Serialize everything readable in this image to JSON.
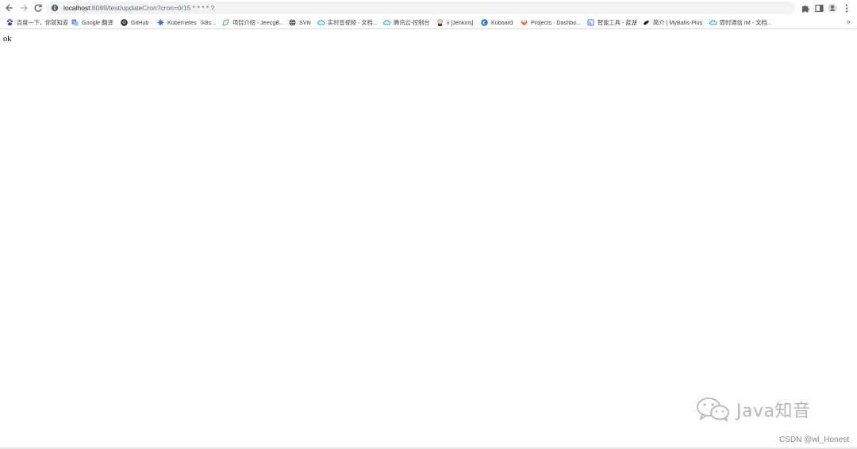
{
  "address_bar": {
    "host": "localhost",
    "rest": ":8089/test/updateCron?cron=0/15 * * * * ?"
  },
  "bookmarks": [
    {
      "label": "百度一下，你就知道",
      "icon": "paw-icon",
      "color": "#2932e1"
    },
    {
      "label": "Google 翻译",
      "icon": "translate-icon",
      "color": "#4285f4"
    },
    {
      "label": "GitHub",
      "icon": "github-icon",
      "color": "#24292e"
    },
    {
      "label": "Kubernetes（k8s...",
      "icon": "helm-icon",
      "color": "#326ce5"
    },
    {
      "label": "项目介绍 - JeecgB...",
      "icon": "leaf-icon",
      "color": "#3fb950"
    },
    {
      "label": "SVN",
      "icon": "globe-icon",
      "color": "#444444"
    },
    {
      "label": "实时音视频 - 文档...",
      "icon": "cloud-icon",
      "color": "#00a4ff"
    },
    {
      "label": "腾讯云-控制台",
      "icon": "cloud-icon",
      "color": "#00a4ff"
    },
    {
      "label": "ii [Jenkins]",
      "icon": "jenkins-icon",
      "color": "#d24939"
    },
    {
      "label": "Kuboard",
      "icon": "kuboard-icon",
      "color": "#1a73e8"
    },
    {
      "label": "Projects · Dashbo...",
      "icon": "gitlab-icon",
      "color": "#fc6d26"
    },
    {
      "label": "智能工具 - 蓝湖",
      "icon": "lanhu-icon",
      "color": "#4a6cf7"
    },
    {
      "label": "简介 | MyBatis-Plus",
      "icon": "bird-icon",
      "color": "#222222"
    },
    {
      "label": "即时通信 IM - 文档...",
      "icon": "cloud-icon",
      "color": "#00a4ff"
    }
  ],
  "page": {
    "body_text": "ok"
  },
  "watermark": {
    "text": "Java知音",
    "credit": "CSDN @wl_Honest"
  }
}
